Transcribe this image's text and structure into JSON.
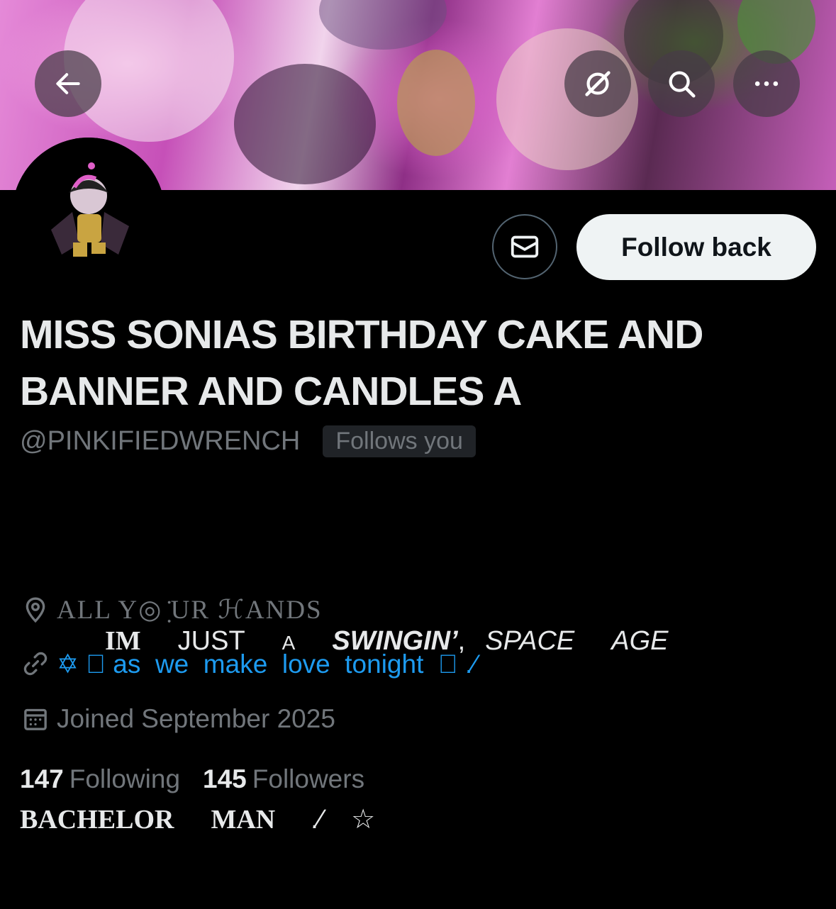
{
  "header": {
    "back_icon": "arrow-left-icon",
    "grok_icon": "grok-icon",
    "search_icon": "search-icon",
    "more_icon": "more-icon"
  },
  "actions": {
    "message_icon": "envelope-icon",
    "follow_label": "Follow back"
  },
  "profile": {
    "display_name": "MISS SONIAS BIRTHDAY CAKE AND BANNER AND CANDLES A",
    "handle": "@PINKIFIEDWRENCH",
    "follows_you": "Follows you",
    "bio_line1_a": "IM",
    "bio_line1_b": "JUST",
    "bio_line1_c": "A",
    "bio_line1_d": "SWINGIN’",
    "bio_line1_e": ",",
    "bio_line1_f": "SPACE",
    "bio_line1_g": "AGE",
    "bio_line2_a": "BACHELOR",
    "bio_line2_b": "MAN",
    "bio_line2_c": ".⁄",
    "bio_line2_d": "☆",
    "location": "ALL Y◎ ̣̇UR ℋANDS",
    "website": "✡ ⃝ as  we  make  love  tonight  ⃝ .⁄",
    "joined": "Joined September 2025",
    "following_count": "147",
    "following_label": "Following",
    "followers_count": "145",
    "followers_label": "Followers"
  },
  "colors": {
    "background": "#000000",
    "accent": "#1d9bf0",
    "secondary_text": "#71767b",
    "primary_text": "#e7e9ea"
  }
}
